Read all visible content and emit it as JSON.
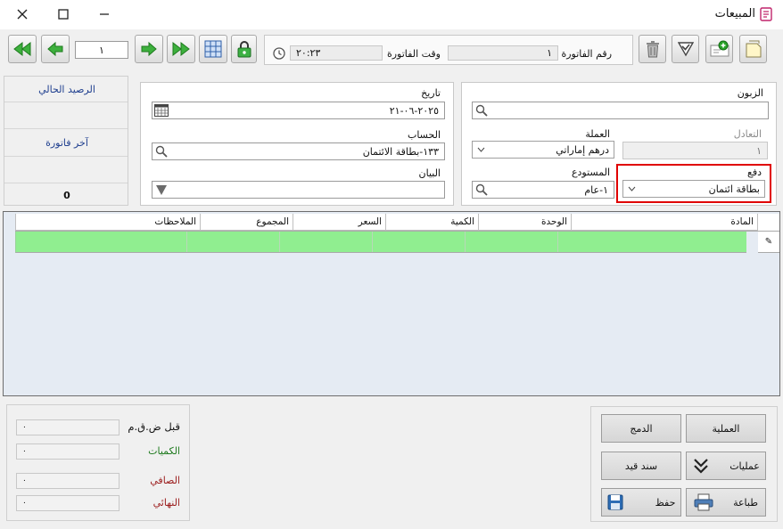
{
  "window": {
    "title": "المبيعات"
  },
  "toolbar": {
    "page_number": "١",
    "invoice_number_label": "رقم الفاتورة",
    "invoice_number": "١",
    "invoice_time_label": "وقت الفاتورة",
    "invoice_time": "٢٠:٢٣"
  },
  "form": {
    "customer_label": "الزبون",
    "customer": "",
    "currency_label": "العملة",
    "currency": "درهم إماراتي",
    "exchange_label": "التعادل",
    "exchange": "١",
    "payment_label": "دفع",
    "payment": "بطاقة ائتمان",
    "warehouse_label": "المستودع",
    "warehouse": "١-عام",
    "date_label": "تاريخ",
    "date": "٢٠٢٥-٠٦-٢١",
    "account_label": "الحساب",
    "account": "١٣٣-بطاقة الائتمان",
    "statement_label": "البيان",
    "statement": ""
  },
  "balance_panel": {
    "current_balance_label": "الرصيد الحالي",
    "last_invoice_label": "آخر فاتورة",
    "value": "0"
  },
  "grid": {
    "columns": [
      "المادة",
      "الوحدة",
      "الكمية",
      "السعر",
      "المجموع",
      "الملاحظات"
    ],
    "row_marker": "✎"
  },
  "totals": {
    "before_vat_label": "قبل ض.ق.م",
    "before_vat": "٠",
    "quantities_label": "الكميات",
    "quantities": "٠",
    "net_label": "الصافي",
    "net": "٠",
    "final_label": "النهائي",
    "final": "٠"
  },
  "actions": {
    "operation": "العملية",
    "merge": "الدمج",
    "operations": "عمليات",
    "journal_voucher": "سند قيد",
    "print": "طباعة",
    "save": "حفظ"
  },
  "colors": {
    "grid_row": "#90ee90",
    "highlight": "#e00000",
    "header_blue": "#1f3f8f"
  }
}
